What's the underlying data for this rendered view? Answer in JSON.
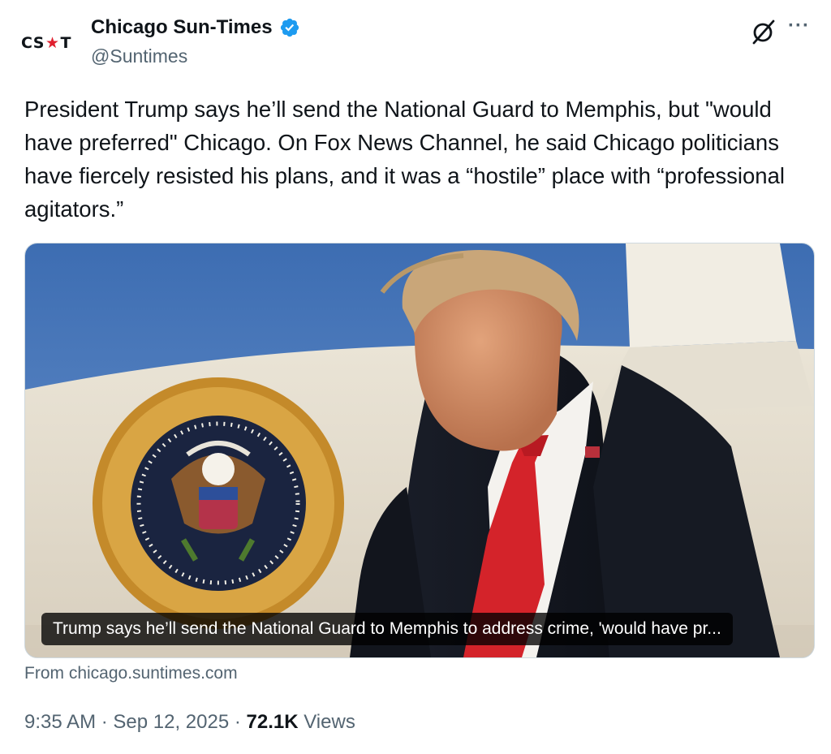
{
  "author": {
    "avatar_left": "CS",
    "avatar_star": "★",
    "avatar_right": "T",
    "display_name": "Chicago Sun-Times",
    "handle": "@Suntimes"
  },
  "icons": {
    "verified": "verified-badge-icon",
    "grok": "grok-icon",
    "more": "more-options-icon"
  },
  "more_glyph": "···",
  "tweet": {
    "text": "President Trump says he’ll send the National Guard to Memphis, but \"would have preferred\" Chicago. On Fox News Channel, he said Chicago politicians have fiercely resisted his plans, and it was a “hostile” place with “professional agitators.”"
  },
  "card": {
    "caption": "Trump says he’ll send the National Guard to Memphis to address crime, 'would have pr...",
    "source": "From chicago.suntimes.com"
  },
  "meta": {
    "time": "9:35 AM",
    "sep1": " · ",
    "date": "Sep 12, 2025",
    "sep2": " · ",
    "views_count": "72.1K",
    "views_label": " Views"
  },
  "colors": {
    "verified_blue": "#1d9bf0",
    "secondary_text": "#536471",
    "primary_text": "#0f1419",
    "sky": "#4f7fbf",
    "tie_red": "#d4232a"
  }
}
